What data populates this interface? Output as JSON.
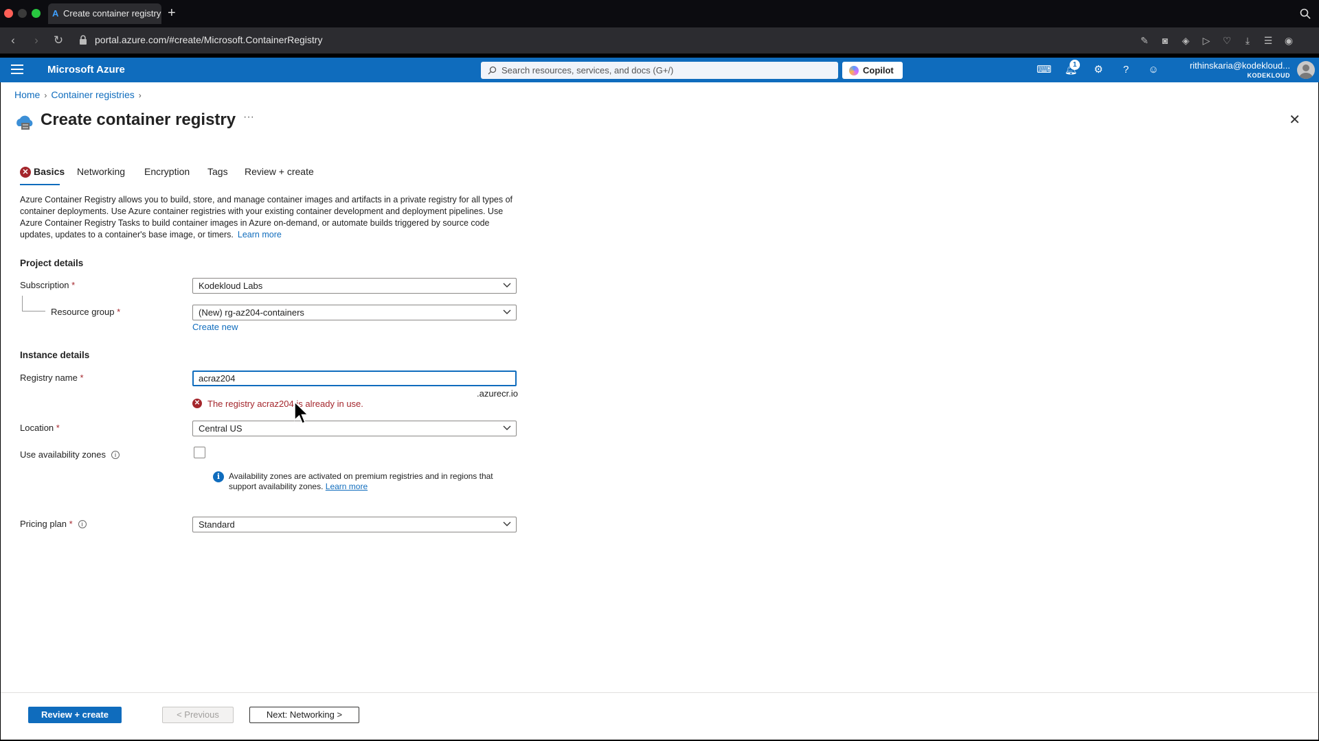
{
  "browser": {
    "tab_title": "Create container registry",
    "new_tab_label": "+",
    "url": "portal.azure.com/#create/Microsoft.ContainerRegistry"
  },
  "header": {
    "brand": "Microsoft Azure",
    "search_placeholder": "Search resources, services, and docs (G+/)",
    "copilot_label": "Copilot",
    "notification_count": "1",
    "user_name": "rithinskaria@kodekloud...",
    "user_org": "KODEKLOUD"
  },
  "breadcrumb": {
    "items": [
      "Home",
      "Container registries"
    ]
  },
  "page": {
    "title": "Create container registry",
    "more_label": "···",
    "close_label": "✕"
  },
  "tabs": [
    "Basics",
    "Networking",
    "Encryption",
    "Tags",
    "Review + create"
  ],
  "description": {
    "text": "Azure Container Registry allows you to build, store, and manage container images and artifacts in a private registry for all types of container deployments. Use Azure container registries with your existing container development and deployment pipelines. Use Azure Container Registry Tasks to build container images in Azure on-demand, or automate builds triggered by source code updates, updates to a container's base image, or timers.",
    "learn_more": "Learn more"
  },
  "project_details": {
    "heading": "Project details",
    "subscription_label": "Subscription",
    "subscription_value": "Kodekloud Labs",
    "resource_group_label": "Resource group",
    "resource_group_value": "(New) rg-az204-containers",
    "create_new": "Create new"
  },
  "instance_details": {
    "heading": "Instance details",
    "registry_name_label": "Registry name",
    "registry_name_value": "acraz204",
    "registry_suffix": ".azurecr.io",
    "error_message": "The registry acraz204 is already in use.",
    "location_label": "Location",
    "location_value": "Central US",
    "availability_label": "Use availability zones",
    "availability_info": "Availability zones are activated on premium registries and in regions that support availability zones.",
    "availability_learn_more": "Learn more",
    "pricing_label": "Pricing plan",
    "pricing_value": "Standard"
  },
  "footer": {
    "review_create": "Review + create",
    "previous": "< Previous",
    "next": "Next: Networking >"
  },
  "colors": {
    "azure_blue": "#0f6cbd",
    "error_red": "#a4262c"
  }
}
